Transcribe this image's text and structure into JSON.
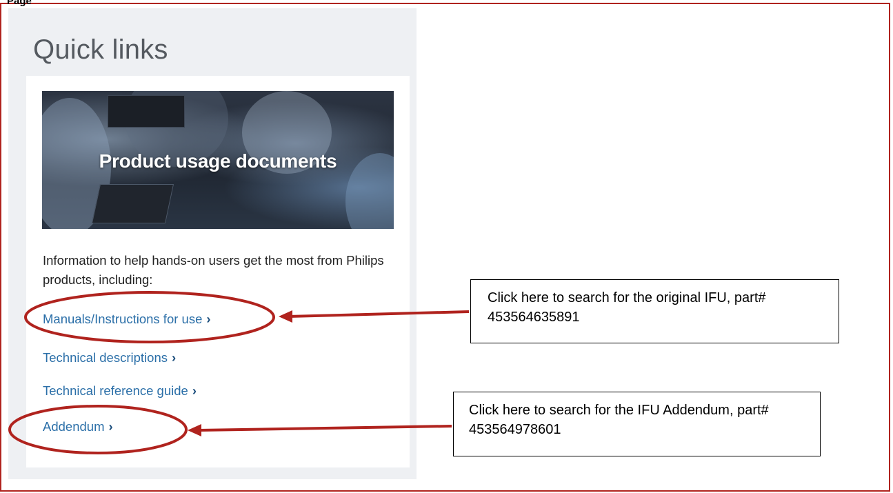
{
  "top_label": "Page",
  "panel": {
    "title": "Quick links"
  },
  "card": {
    "hero_title": "Product usage documents",
    "description": "Information to help hands-on users get the most from Philips products, including:",
    "links": [
      {
        "label": "Manuals/Instructions for use",
        "chevron": "›"
      },
      {
        "label": "Technical descriptions",
        "chevron": "›"
      },
      {
        "label": "Technical reference guide",
        "chevron": "›"
      },
      {
        "label": "Addendum",
        "chevron": "›"
      }
    ]
  },
  "callouts": [
    {
      "text": "Click here to search for the original IFU, part# 453564635891"
    },
    {
      "text": "Click here to search for the IFU Addendum, part# 453564978601"
    }
  ],
  "colors": {
    "annotation": "#b0231e",
    "link": "#2b6fa8",
    "panel_bg": "#eef0f3"
  }
}
